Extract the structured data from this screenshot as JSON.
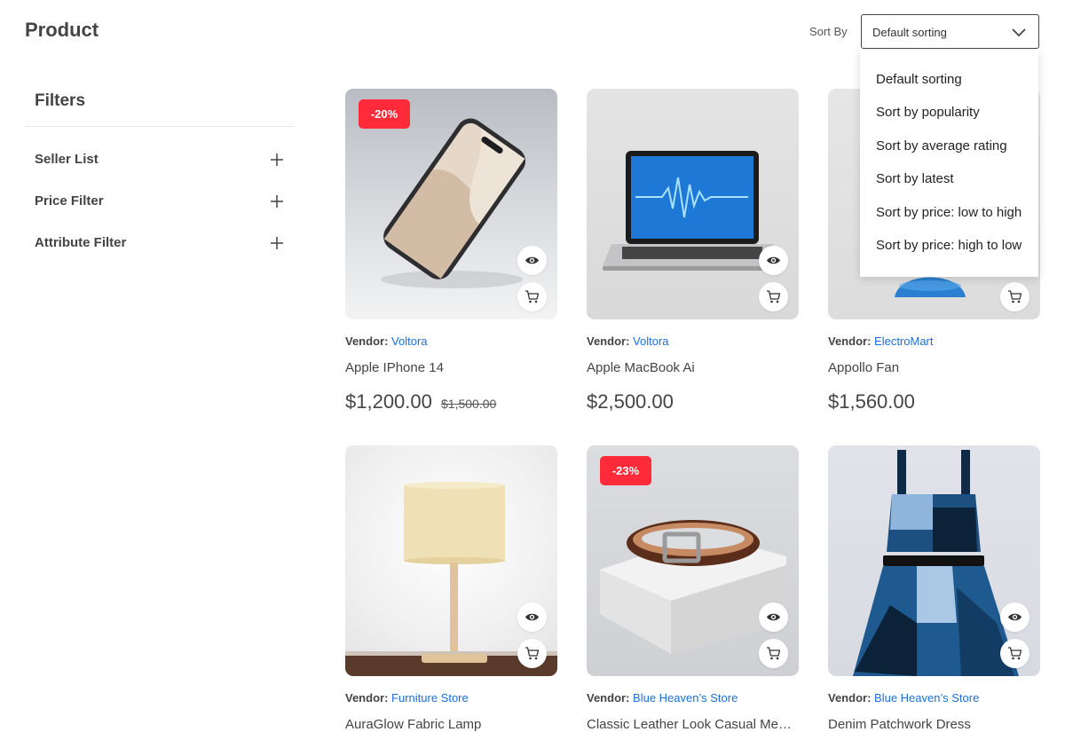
{
  "header": {
    "title": "Product"
  },
  "sort": {
    "label": "Sort By",
    "selected": "Default sorting",
    "options": [
      "Default sorting",
      "Sort by popularity",
      "Sort by average rating",
      "Sort by latest",
      "Sort by price: low to high",
      "Sort by price: high to low"
    ]
  },
  "filters": {
    "title": "Filters",
    "items": [
      "Seller List",
      "Price Filter",
      "Attribute Filter"
    ]
  },
  "vendor_label": "Vendor:",
  "products": [
    {
      "vendor": "Voltora",
      "name": "Apple IPhone 14",
      "price": "$1,200.00",
      "old_price": "$1,500.00",
      "badge": "-20%"
    },
    {
      "vendor": "Voltora",
      "name": "Apple MacBook Ai",
      "price": "$2,500.00"
    },
    {
      "vendor": "ElectroMart",
      "name": "Appollo Fan",
      "price": "$1,560.00"
    },
    {
      "vendor": "Furniture Store",
      "name": "AuraGlow Fabric Lamp"
    },
    {
      "vendor": "Blue Heaven’s Store",
      "name": "Classic Leather Look Casual Men’s Belt",
      "badge": "-23%"
    },
    {
      "vendor": "Blue Heaven’s Store",
      "name": "Denim Patchwork Dress"
    }
  ],
  "colors": {
    "accent_link": "#1a6fe0",
    "badge": "#ff2b3a"
  }
}
